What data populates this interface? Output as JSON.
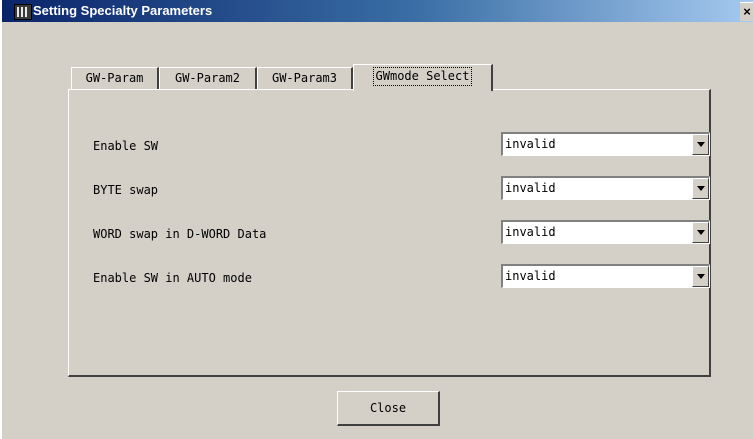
{
  "window": {
    "title": "Setting Specialty Parameters",
    "close_glyph": "×"
  },
  "tabs": [
    {
      "label": "GW-Param",
      "active": false
    },
    {
      "label": "GW-Param2",
      "active": false
    },
    {
      "label": "GW-Param3",
      "active": false
    },
    {
      "label": "GWmode Select",
      "active": true
    }
  ],
  "settings": [
    {
      "label": "Enable SW",
      "value": "invalid"
    },
    {
      "label": "BYTE swap",
      "value": "invalid"
    },
    {
      "label": "WORD swap in D-WORD Data",
      "value": "invalid"
    },
    {
      "label": "Enable SW in AUTO mode",
      "value": "invalid"
    }
  ],
  "footer": {
    "close_label": "Close"
  },
  "colors": {
    "titlebar_start": "#0a246a",
    "titlebar_end": "#a6caf0",
    "face": "#d4d0c8"
  }
}
